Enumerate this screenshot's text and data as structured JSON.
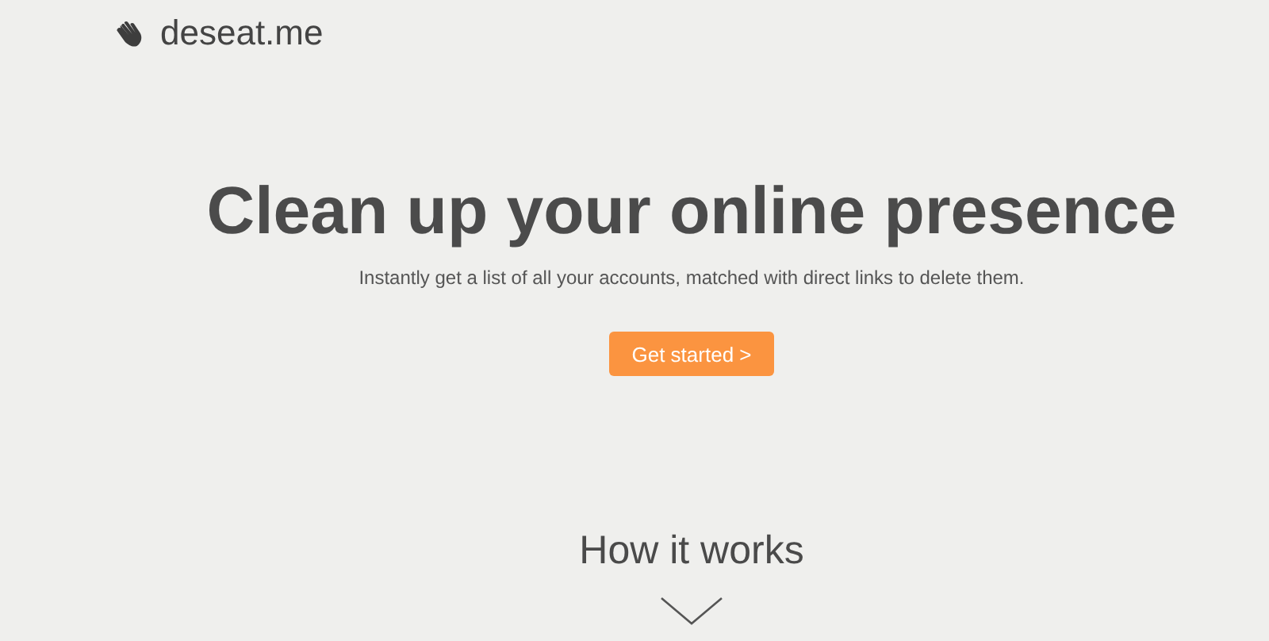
{
  "header": {
    "logo_text": "deseat.me"
  },
  "hero": {
    "title": "Clean up your online presence",
    "subtitle": "Instantly get a list of all your accounts, matched with direct links to delete them.",
    "button": "Get started >"
  },
  "how_it_works": {
    "heading": "How it works"
  }
}
